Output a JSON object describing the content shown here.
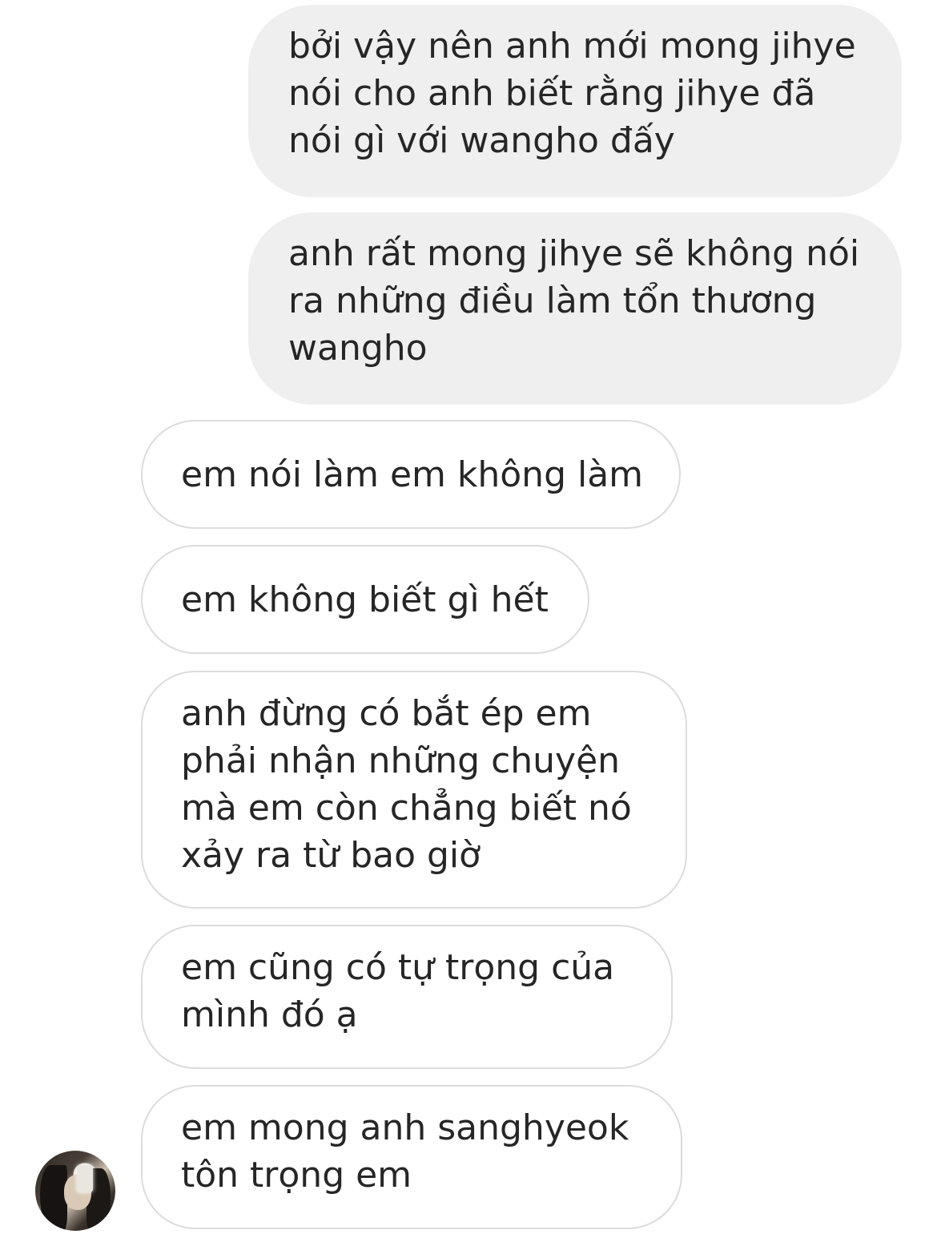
{
  "messages": [
    {
      "direction": "sent",
      "text": "bởi vậy nên anh mới mong jihye\nnói cho anh biết rằng jihye đã\nnói gì với wangho đấy"
    },
    {
      "direction": "sent",
      "text": "anh rất mong jihye sẽ không nói\nra những điều làm tổn thương\nwangho"
    },
    {
      "direction": "received",
      "text": "em nói làm em không làm"
    },
    {
      "direction": "received",
      "text": "em không biết gì hết"
    },
    {
      "direction": "received",
      "text": "anh đừng có bắt ép em\nphải nhận những chuyện\nmà em còn chẳng biết nó\nxảy ra từ bao giờ"
    },
    {
      "direction": "received",
      "text": "em cũng có tự trọng của\nmình đó ạ"
    },
    {
      "direction": "received",
      "text": "em mong anh sanghyeok\ntôn trọng em"
    }
  ],
  "colors": {
    "sent_bubble": "#efefef",
    "received_border": "#dcdcdc",
    "text": "#262626"
  },
  "avatar": {
    "icon": "user-avatar-photo"
  }
}
